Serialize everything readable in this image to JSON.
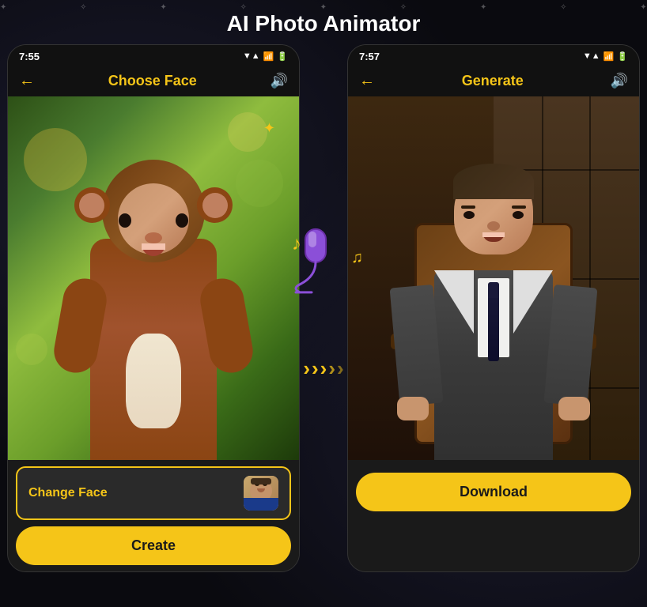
{
  "app": {
    "title": "AI Photo Animator"
  },
  "phone_left": {
    "status_time": "7:55",
    "header_title": "Choose Face",
    "header_title_color": "yellow",
    "back_icon": "←",
    "sound_icon": "🔊",
    "change_face_label": "Change Face",
    "create_button_label": "Create"
  },
  "phone_right": {
    "status_time": "7:57",
    "header_title": "Generate",
    "header_title_color": "white",
    "back_icon": "←",
    "sound_icon": "🔊",
    "download_button_label": "Download"
  },
  "decorations": {
    "mic_emoji": "🎤",
    "music_note1": "♪",
    "music_note2": "♫",
    "arrow1": "»",
    "arrow2": "»",
    "arrow3": "»",
    "sparkle": "✦"
  },
  "status_icons": {
    "signal": "▼▲",
    "bars": "▌▌",
    "battery": "🔋"
  }
}
